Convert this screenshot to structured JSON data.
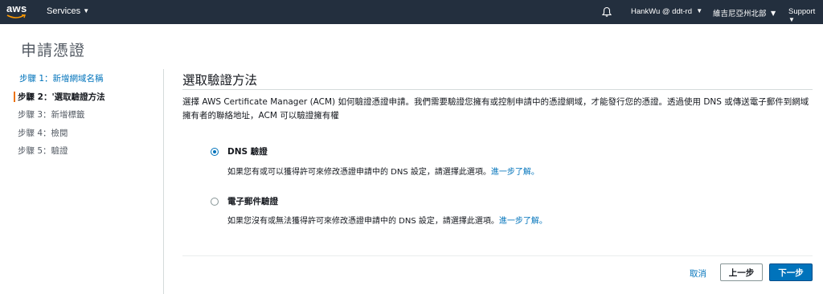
{
  "nav": {
    "logo_text": "aws",
    "services": "Services",
    "user": "HankWu @ ddt-rd",
    "region": "維吉尼亞州北部",
    "support": "Support"
  },
  "page": {
    "title": "申請憑證"
  },
  "steps": [
    {
      "label": "步驟 1：新增網域名稱"
    },
    {
      "label": "步驟 2：'選取驗證方法"
    },
    {
      "label": "步驟 3：新增標籤"
    },
    {
      "label": "步驟 4：檢閱"
    },
    {
      "label": "步驟 5：驗證"
    }
  ],
  "main": {
    "section_title": "選取驗證方法",
    "description": "選擇 AWS Certificate Manager (ACM) 如何驗證憑證申請。我們需要驗證您擁有或控制申請中的憑證網域，才能發行您的憑證。透過使用 DNS 或傳送電子郵件到網域擁有者的聯絡地址，ACM 可以驗證擁有權",
    "options": [
      {
        "label": "DNS 驗證",
        "description": "如果您有或可以獲得許可來修改憑證申請中的 DNS 設定，請選擇此選項。",
        "link": "進一步了解。",
        "selected": true
      },
      {
        "label": "電子郵件驗證",
        "description": "如果您沒有或無法獲得許可來修改憑證申請中的 DNS 設定，請選擇此選項。",
        "link": "進一步了解。",
        "selected": false
      }
    ]
  },
  "footer": {
    "cancel": "取消",
    "previous": "上一步",
    "next": "下一步"
  },
  "colors": {
    "nav_bg": "#232f3e",
    "accent_orange": "#ec7211",
    "link_blue": "#0073bb",
    "primary_button": "#0073bb"
  }
}
